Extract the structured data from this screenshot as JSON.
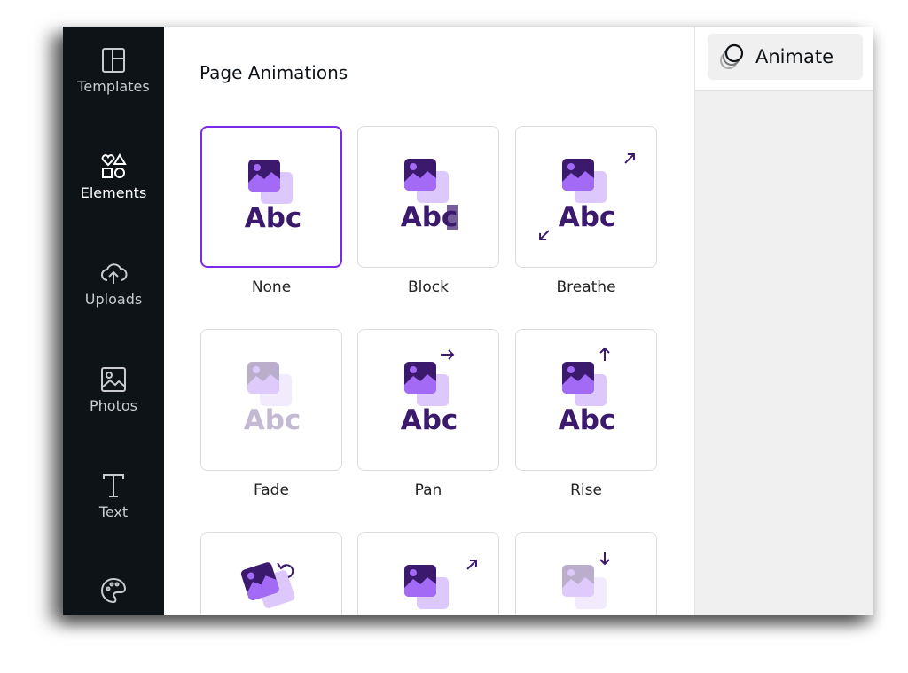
{
  "sidebar": {
    "items": [
      {
        "label": "Templates",
        "icon": "templates-icon"
      },
      {
        "label": "Elements",
        "icon": "elements-icon",
        "active": true
      },
      {
        "label": "Uploads",
        "icon": "upload-cloud-icon"
      },
      {
        "label": "Photos",
        "icon": "photo-icon"
      },
      {
        "label": "Text",
        "icon": "text-icon"
      },
      {
        "label": "",
        "icon": "palette-icon"
      }
    ]
  },
  "panel": {
    "title": "Page Animations",
    "sample_text": "Abc",
    "animations": [
      {
        "label": "None",
        "selected": true,
        "effect": "none"
      },
      {
        "label": "Block",
        "effect": "block"
      },
      {
        "label": "Breathe",
        "effect": "breathe"
      },
      {
        "label": "Fade",
        "effect": "fade"
      },
      {
        "label": "Pan",
        "effect": "pan"
      },
      {
        "label": "Rise",
        "effect": "rise"
      },
      {
        "label": "",
        "effect": "tumble"
      },
      {
        "label": "",
        "effect": "pop"
      },
      {
        "label": "",
        "effect": "drift"
      }
    ]
  },
  "toolbar": {
    "animate_label": "Animate"
  },
  "colors": {
    "accent": "#7d2ae8",
    "sidebar": "#0e1318",
    "icon_dark": "#3b1a6e",
    "icon_mid": "#a36bf5",
    "icon_light": "#dcc8fb"
  }
}
